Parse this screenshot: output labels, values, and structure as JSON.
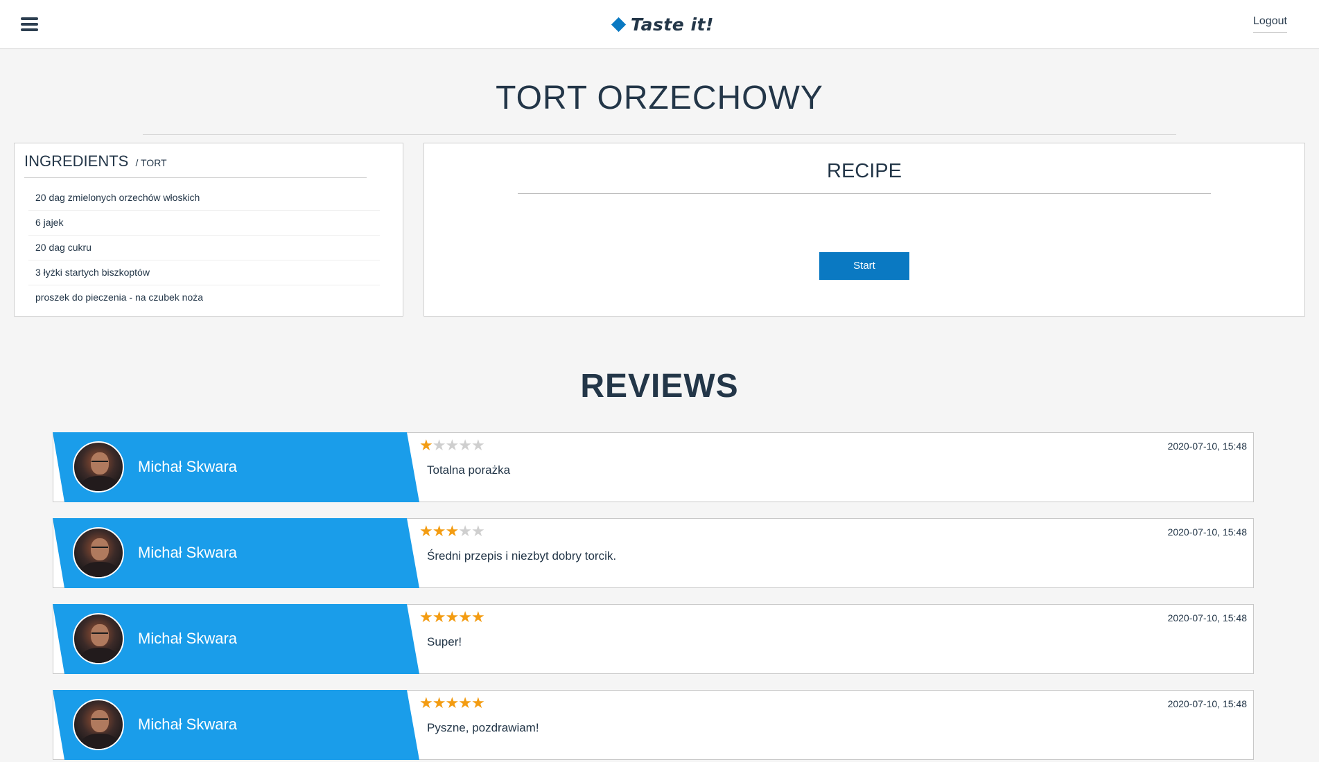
{
  "header": {
    "logo_text": "Taste it!",
    "logout_label": "Logout"
  },
  "page": {
    "title": "TORT ORZECHOWY"
  },
  "ingredients": {
    "heading": "INGREDIENTS",
    "subheading": "/ TORT",
    "items": [
      "20 dag zmielonych orzechów włoskich",
      "6 jajek",
      "20 dag cukru",
      "3 łyżki startych biszkoptów",
      "proszek do pieczenia - na czubek noża"
    ]
  },
  "recipe": {
    "heading": "RECIPE",
    "start_label": "Start"
  },
  "reviews": {
    "heading": "REVIEWS",
    "items": [
      {
        "author": "Michał Skwara",
        "rating": 1,
        "date": "2020-07-10, 15:48",
        "text": "Totalna porażka"
      },
      {
        "author": "Michał Skwara",
        "rating": 3,
        "date": "2020-07-10, 15:48",
        "text": "Średni przepis i niezbyt dobry torcik."
      },
      {
        "author": "Michał Skwara",
        "rating": 5,
        "date": "2020-07-10, 15:48",
        "text": "Super!"
      },
      {
        "author": "Michał Skwara",
        "rating": 5,
        "date": "2020-07-10, 15:48",
        "text": "Pyszne, pozdrawiam!"
      }
    ],
    "max_rating": 5
  },
  "colors": {
    "accent": "#0a79c2",
    "banner": "#1a9dea",
    "star_on": "#f39c12",
    "star_off": "#cfcfcf"
  }
}
